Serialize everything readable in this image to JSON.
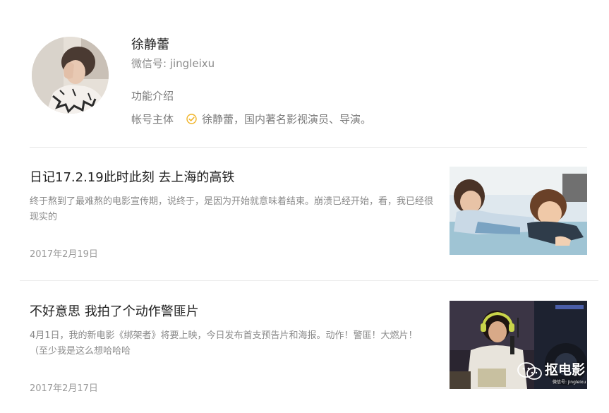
{
  "profile": {
    "name": "徐静蕾",
    "wechat_id": "微信号: jingleixu",
    "function_label": "功能介绍",
    "owner_label": "帐号主体",
    "owner_value": "徐静蕾，国内著名影视演员、导演。",
    "verified_icon": "verified-check-icon",
    "verified_color": "#f0b429"
  },
  "articles": [
    {
      "title": "日记17.2.19此时此刻 去上海的高铁",
      "summary": "终于熬到了最难熬的电影宣传期，说终于，是因为开始就意味着结束。崩溃已经开始，看，我已经很现实的",
      "date": "2017年2月19日"
    },
    {
      "title": "不好意思 我拍了个动作警匪片",
      "summary": "4月1日，我的新电影《绑架者》将要上映，今日发布首支预告片和海报。动作！警匪！大燃片！（至少我是这么想哈哈哈",
      "date": "2017年2月17日"
    }
  ],
  "watermark": {
    "title": "抠电影",
    "subtitle": "微信号: jingleixu",
    "icon": "wechat-icon"
  },
  "colors": {
    "title_text": "#222222",
    "secondary_text": "#8a8a8a",
    "divider": "#e5e5e5"
  }
}
